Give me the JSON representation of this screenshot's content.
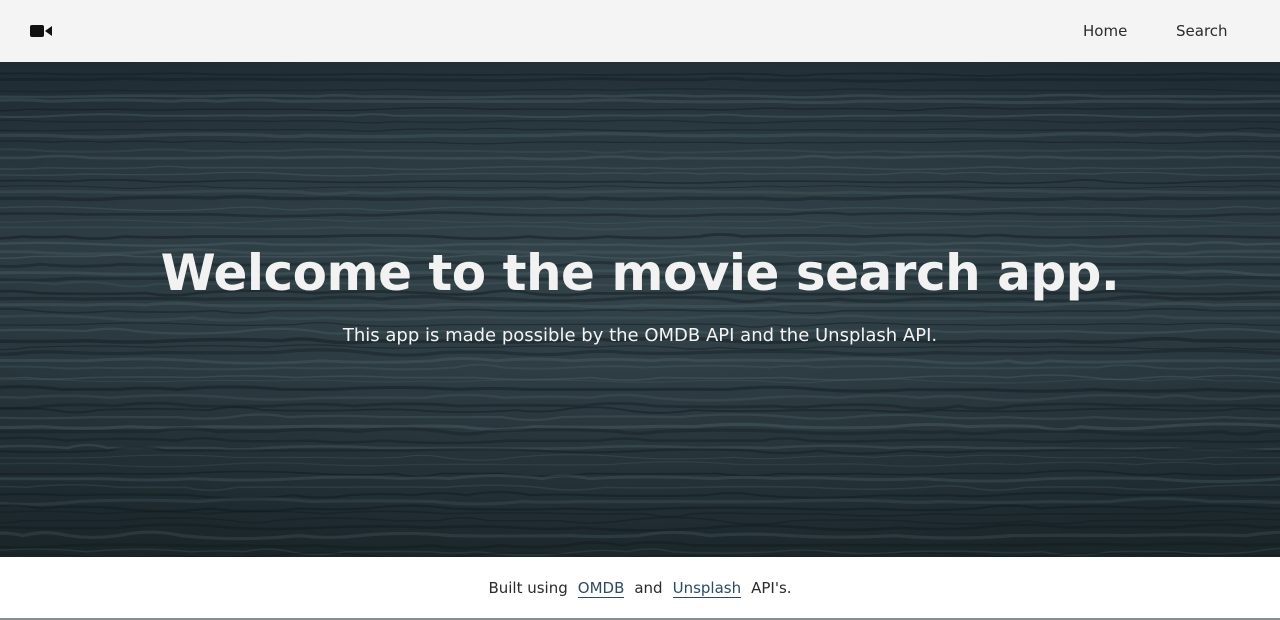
{
  "navbar": {
    "logo_icon": "video-camera-icon",
    "links": [
      {
        "label": "Home"
      },
      {
        "label": "Search"
      }
    ]
  },
  "hero": {
    "title": "Welcome to the movie search app.",
    "subtitle": "This app is made possible by the OMDB API and the Unsplash API."
  },
  "footer": {
    "prefix": "Built using",
    "link1": "OMDB",
    "connector": "and",
    "link2": "Unsplash",
    "suffix": "API's."
  },
  "colors": {
    "navbar_bg": "#f4f4f4",
    "hero_bg": "#1e2a32",
    "link": "#2c4a66"
  }
}
